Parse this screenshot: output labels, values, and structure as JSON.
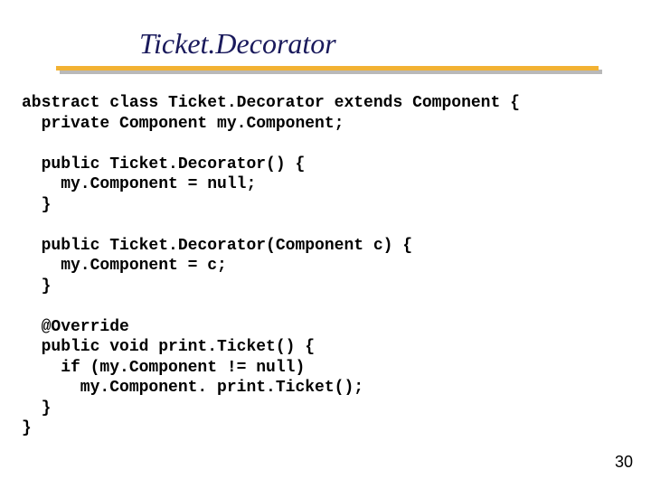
{
  "title": "Ticket.Decorator",
  "code": "abstract class Ticket.Decorator extends Component {\n  private Component my.Component;\n\n  public Ticket.Decorator() {\n    my.Component = null;\n  }\n\n  public Ticket.Decorator(Component c) {\n    my.Component = c;\n  }\n\n  @Override\n  public void print.Ticket() {\n    if (my.Component != null)\n      my.Component. print.Ticket();\n  }\n}",
  "page_number": "30"
}
